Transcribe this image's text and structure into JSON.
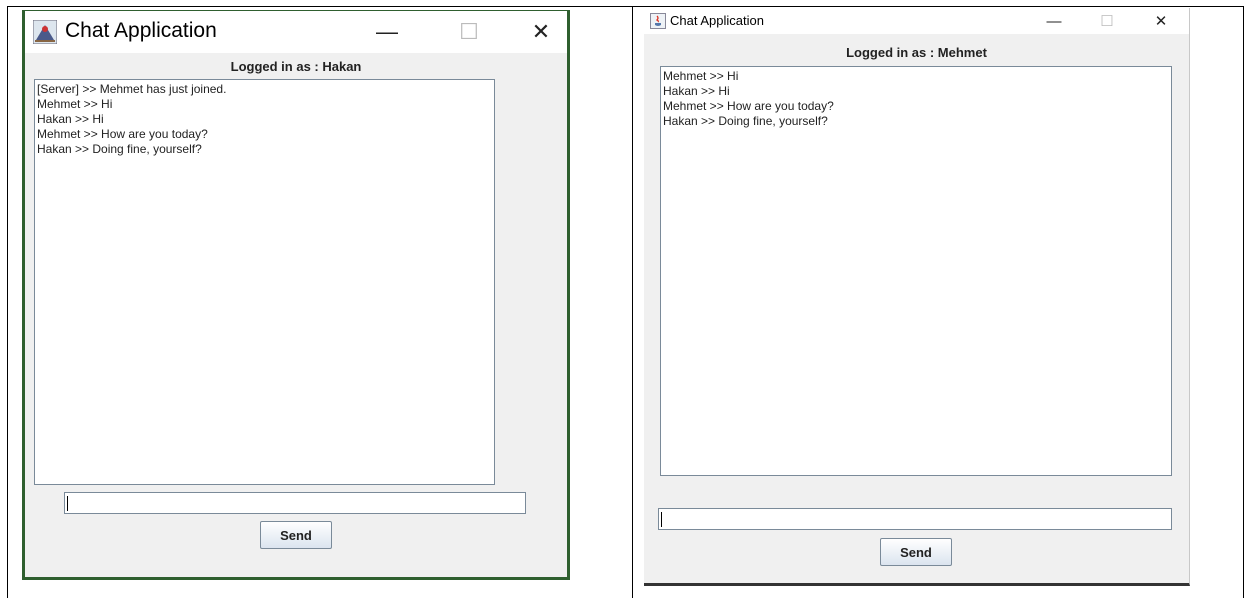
{
  "windows": [
    {
      "title": "Chat Application",
      "controls": {
        "minimize": "—",
        "maximize": "☐",
        "close": "✕"
      },
      "logged_in_label": "Logged in as : Hakan",
      "messages": [
        "[Server] >> Mehmet has just joined.",
        "Mehmet >> Hi",
        "Hakan >> Hi",
        "Mehmet >> How are you today?",
        "Hakan >> Doing fine, yourself?"
      ],
      "input_value": "",
      "send_label": "Send"
    },
    {
      "title": "Chat Application",
      "controls": {
        "minimize": "—",
        "maximize": "☐",
        "close": "✕"
      },
      "logged_in_label": "Logged in as : Mehmet",
      "messages": [
        "Mehmet >> Hi",
        "Hakan >> Hi",
        "Mehmet >> How are you today?",
        "Hakan >> Doing fine, yourself?"
      ],
      "input_value": "",
      "send_label": "Send"
    }
  ]
}
